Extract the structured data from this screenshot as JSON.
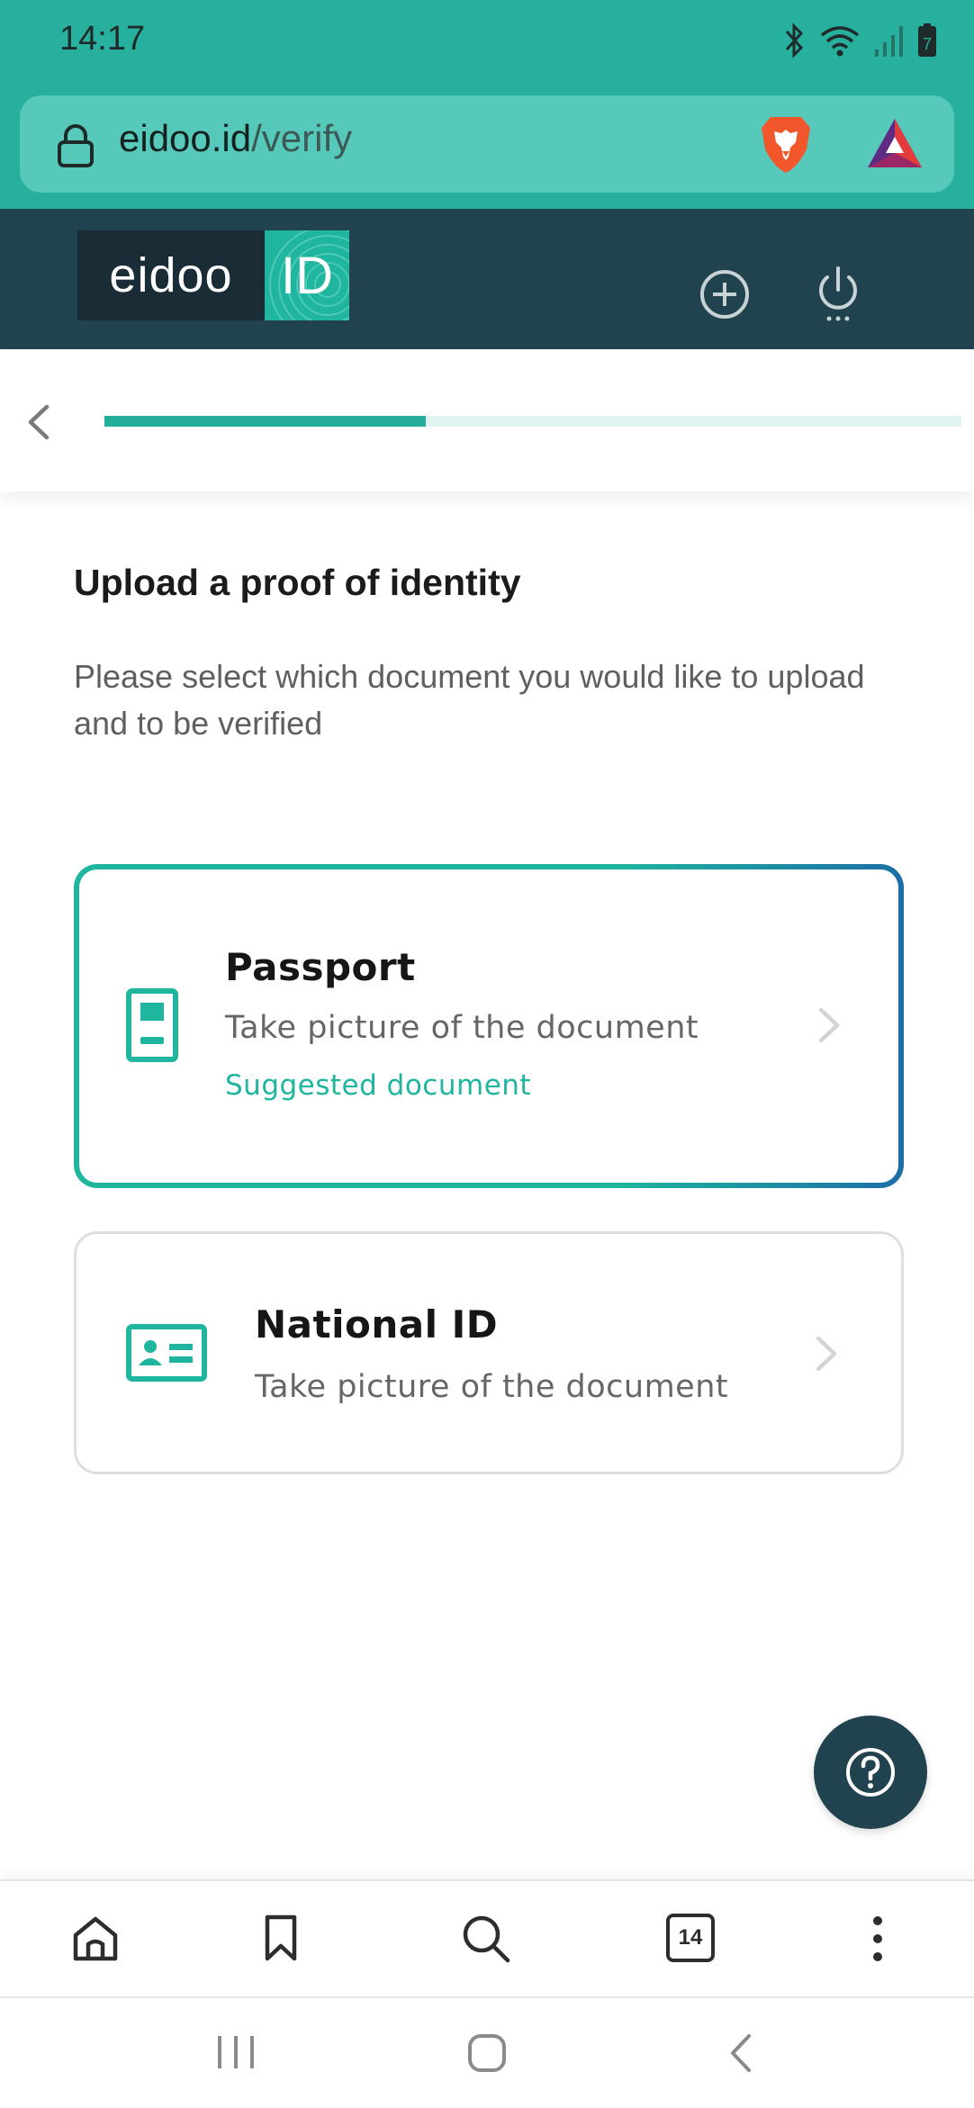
{
  "status_bar": {
    "time": "14:17",
    "battery_level": "7",
    "icons": [
      "bluetooth-icon",
      "wifi-icon",
      "signal-icon",
      "battery-icon"
    ]
  },
  "browser": {
    "url_host": "eidoo.id",
    "url_path": "/verify",
    "toolbar": {
      "tabs_count": "14",
      "icons": [
        "home-icon",
        "bookmark-icon",
        "search-icon",
        "tabs-icon",
        "more-icon"
      ]
    }
  },
  "app": {
    "logo_left": "eidoo",
    "logo_right": "ID",
    "progress_fraction": 0.375
  },
  "content": {
    "title": "Upload a proof of identity",
    "description": "Please select which document you would like to upload and to be verified",
    "documents": [
      {
        "title": "Passport",
        "subtitle": "Take picture of the document",
        "tag": "Suggested document"
      },
      {
        "title": "National ID",
        "subtitle": "Take picture of the document"
      }
    ]
  },
  "colors": {
    "accent": "#1fb59e",
    "header": "#21424f",
    "browser_bar": "#27b09d",
    "url_box": "#57c9bb",
    "passport_border_end": "#1d6ea6"
  }
}
